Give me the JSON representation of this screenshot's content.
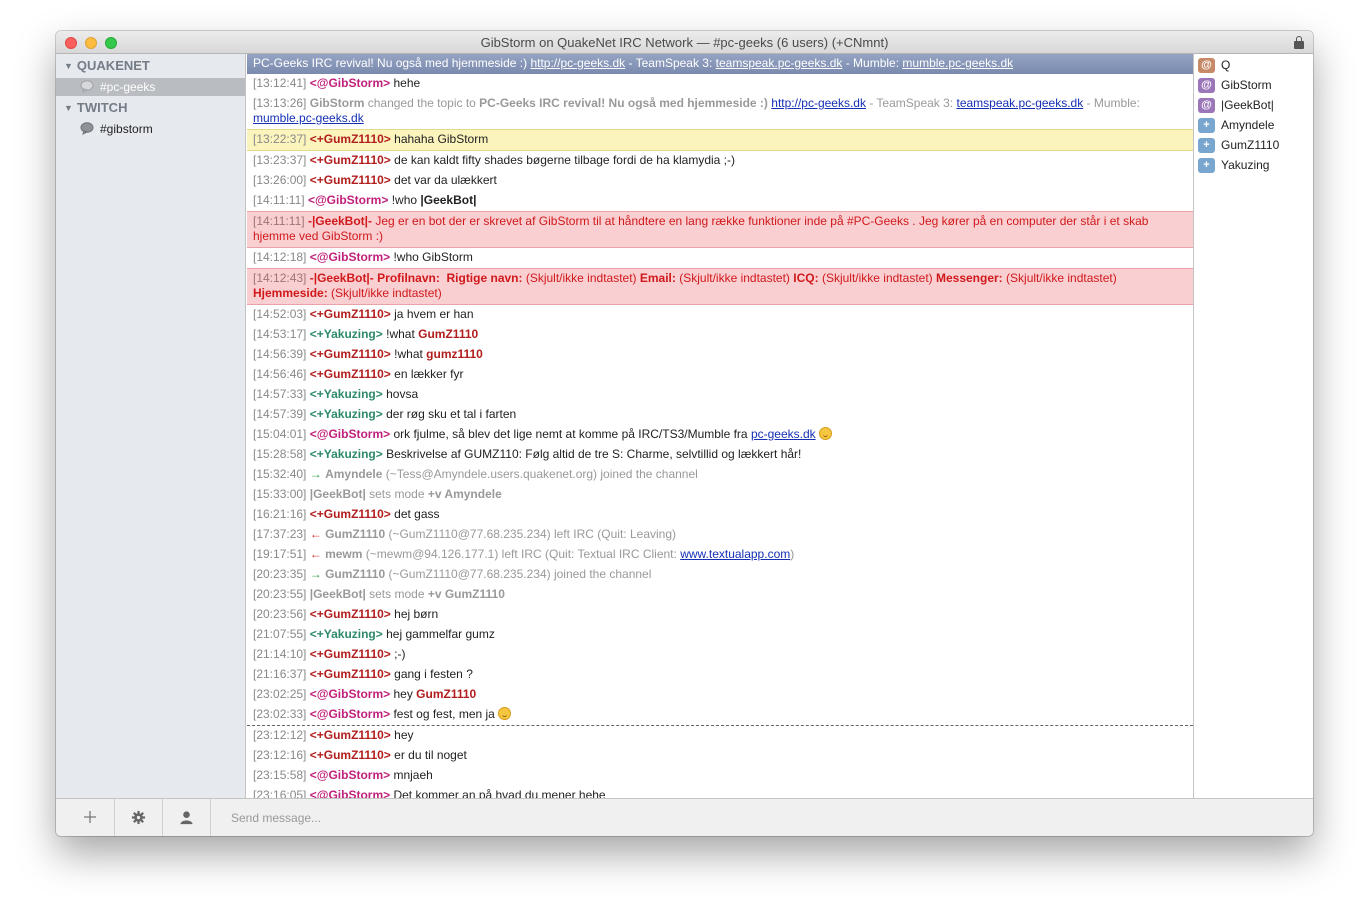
{
  "window": {
    "title": "GibStorm on QuakeNet IRC Network — #pc-geeks (6 users) (+CNmnt)"
  },
  "sidebar": {
    "networks": [
      {
        "name": "QUAKENET",
        "channels": [
          {
            "name": "#pc-geeks",
            "selected": true
          }
        ]
      },
      {
        "name": "TWITCH",
        "channels": [
          {
            "name": "#gibstorm",
            "selected": false
          }
        ]
      }
    ]
  },
  "topic": {
    "text": "PC-Geeks IRC revival! Nu også med hjemmeside :) ",
    "link1": "http://pc-geeks.dk",
    "mid1": " - TeamSpeak 3: ",
    "link2": "teamspeak.pc-geeks.dk",
    "mid2": " - Mumble: ",
    "link3": "mumble.pc-geeks.dk"
  },
  "messages": {
    "m01": {
      "ts": "[13:12:41]",
      "nick": "<@GibStorm>",
      "text": "hehe"
    },
    "m02": {
      "ts": "[13:13:26]",
      "nick": "GibStorm",
      "pre": " changed the topic to ",
      "bold": "PC-Geeks IRC revival! Nu også med hjemmeside :) ",
      "link1": "http://pc-geeks.dk",
      "mid1": " - TeamSpeak 3: ",
      "link2": "teamspeak.pc-geeks.dk",
      "mid2": " - Mumble: ",
      "link3": "mumble.pc-geeks.dk"
    },
    "m03": {
      "ts": "[13:22:37]",
      "nick": "<+GumZ1110>",
      "text": "hahaha GibStorm"
    },
    "m04": {
      "ts": "[13:23:37]",
      "nick": "<+GumZ1110>",
      "text": "de kan kaldt fifty shades bøgerne tilbage fordi de ha klamydia ;-)"
    },
    "m05": {
      "ts": "[13:26:00]",
      "nick": "<+GumZ1110>",
      "text": "det var da ulækkert"
    },
    "m06": {
      "ts": "[14:11:11]",
      "nick": "<@GibStorm>",
      "pre": "!who ",
      "bold": "|GeekBot|"
    },
    "m07": {
      "ts": "[14:11:11]",
      "nick": "-|GeekBot|-",
      "text": "Jeg er en bot der er skrevet af GibStorm til at håndtere en lang række funktioner inde på #PC-Geeks . Jeg kører på en computer der står i et skab hjemme ved GibStorm :)"
    },
    "m08": {
      "ts": "[14:12:18]",
      "nick": "<@GibStorm>",
      "text": "!who GibStorm"
    },
    "m09": {
      "ts": "[14:12:43]",
      "nick": "-|GeekBot|-",
      "l1": "Profilnavn:",
      "l2": "Rigtige navn:",
      "v2": " (Skjult/ikke indtastet) ",
      "l3": "Email:",
      "v3": " (Skjult/ikke indtastet) ",
      "l4": "ICQ:",
      "v4": " (Skjult/ikke indtastet) ",
      "l5": "Messenger:",
      "v5": " (Skjult/ikke indtastet) ",
      "l6": "Hjemmeside:",
      "v6": " (Skjult/ikke indtastet)"
    },
    "m10": {
      "ts": "[14:52:03]",
      "nick": "<+GumZ1110>",
      "text": "ja hvem er han"
    },
    "m11": {
      "ts": "[14:53:17]",
      "nick": "<+Yakuzing>",
      "pre": "!what ",
      "bold": "GumZ1110"
    },
    "m12": {
      "ts": "[14:56:39]",
      "nick": "<+GumZ1110>",
      "pre": "!what ",
      "bold": "gumz1110"
    },
    "m13": {
      "ts": "[14:56:46]",
      "nick": "<+GumZ1110>",
      "text": "en lækker fyr"
    },
    "m14": {
      "ts": "[14:57:33]",
      "nick": "<+Yakuzing>",
      "text": "hovsa"
    },
    "m15": {
      "ts": "[14:57:39]",
      "nick": "<+Yakuzing>",
      "text": "der røg sku et tal i farten"
    },
    "m16": {
      "ts": "[15:04:01]",
      "nick": "<@GibStorm>",
      "pre": "ork fjulme, så blev det lige nemt at komme på IRC/TS3/Mumble fra ",
      "link": "pc-geeks.dk"
    },
    "m17": {
      "ts": "[15:28:58]",
      "nick": "<+Yakuzing>",
      "text": "Beskrivelse af GUMZ110: Følg altid de tre S: Charme, selvtillid og lækkert hår!"
    },
    "m18": {
      "ts": "[15:32:40]",
      "arrow": "→",
      "nick": "Amyndele",
      "text": " (~Tess@Amyndele.users.quakenet.org) joined the channel"
    },
    "m19": {
      "ts": "[15:33:00]",
      "nick": "|GeekBot|",
      "pre": " sets mode ",
      "bold": "+v Amyndele"
    },
    "m20": {
      "ts": "[16:21:16]",
      "nick": "<+GumZ1110>",
      "text": "det gass"
    },
    "m21": {
      "ts": "[17:37:23]",
      "arrow": "←",
      "nick": "GumZ1110",
      "text": " (~GumZ1110@77.68.235.234) left IRC (Quit: Leaving)"
    },
    "m22": {
      "ts": "[19:17:51]",
      "arrow": "←",
      "nick": "mewm",
      "pre": " (~mewm@94.126.177.1) left IRC (Quit: Textual IRC Client: ",
      "link": "www.textualapp.com",
      "post": ")"
    },
    "m23": {
      "ts": "[20:23:35]",
      "arrow": "→",
      "nick": "GumZ1110",
      "text": " (~GumZ1110@77.68.235.234) joined the channel"
    },
    "m24": {
      "ts": "[20:23:55]",
      "nick": "|GeekBot|",
      "pre": " sets mode ",
      "bold": "+v GumZ1110"
    },
    "m25": {
      "ts": "[20:23:56]",
      "nick": "<+GumZ1110>",
      "text": "hej børn"
    },
    "m26": {
      "ts": "[21:07:55]",
      "nick": "<+Yakuzing>",
      "text": "hej gammelfar gumz"
    },
    "m27": {
      "ts": "[21:14:10]",
      "nick": "<+GumZ1110>",
      "text": ";-)"
    },
    "m28": {
      "ts": "[21:16:37]",
      "nick": "<+GumZ1110>",
      "text": "gang i festen ?"
    },
    "m29": {
      "ts": "[23:02:25]",
      "nick": "<@GibStorm>",
      "pre": "hey ",
      "bold": "GumZ1110"
    },
    "m30": {
      "ts": "[23:02:33]",
      "nick": "<@GibStorm>",
      "text": "fest og fest, men ja"
    },
    "m31": {
      "ts": "[23:12:12]",
      "nick": "<+GumZ1110>",
      "text": "hey"
    },
    "m32": {
      "ts": "[23:12:16]",
      "nick": "<+GumZ1110>",
      "text": "er du til noget"
    },
    "m33": {
      "ts": "[23:15:58]",
      "nick": "<@GibStorm>",
      "text": "mnjaeh"
    },
    "m34": {
      "ts": "[23:16:05]",
      "nick": "<@GibStorm>",
      "text": "Det kommer an på hvad du mener hehe"
    }
  },
  "users": [
    {
      "badge": "@",
      "name": "Q",
      "color": "#c68a68"
    },
    {
      "badge": "@",
      "name": "GibStorm",
      "color": "#9b76b9"
    },
    {
      "badge": "@",
      "name": "|GeekBot|",
      "color": "#9b76b9"
    },
    {
      "badge": "+",
      "name": "Amyndele",
      "color": "#78a6cf"
    },
    {
      "badge": "+",
      "name": "GumZ1110",
      "color": "#78a6cf"
    },
    {
      "badge": "+",
      "name": "Yakuzing",
      "color": "#78a6cf"
    }
  ],
  "input": {
    "placeholder": "Send message..."
  },
  "colors": {
    "op_nick": "#c0207a",
    "gumz_nick": "#b21d1d",
    "yak_nick": "#2d8a6a",
    "highlight": "#fbf4bd",
    "bot_notice": "#f9cfd2",
    "topic_bar": "#8594b8"
  }
}
